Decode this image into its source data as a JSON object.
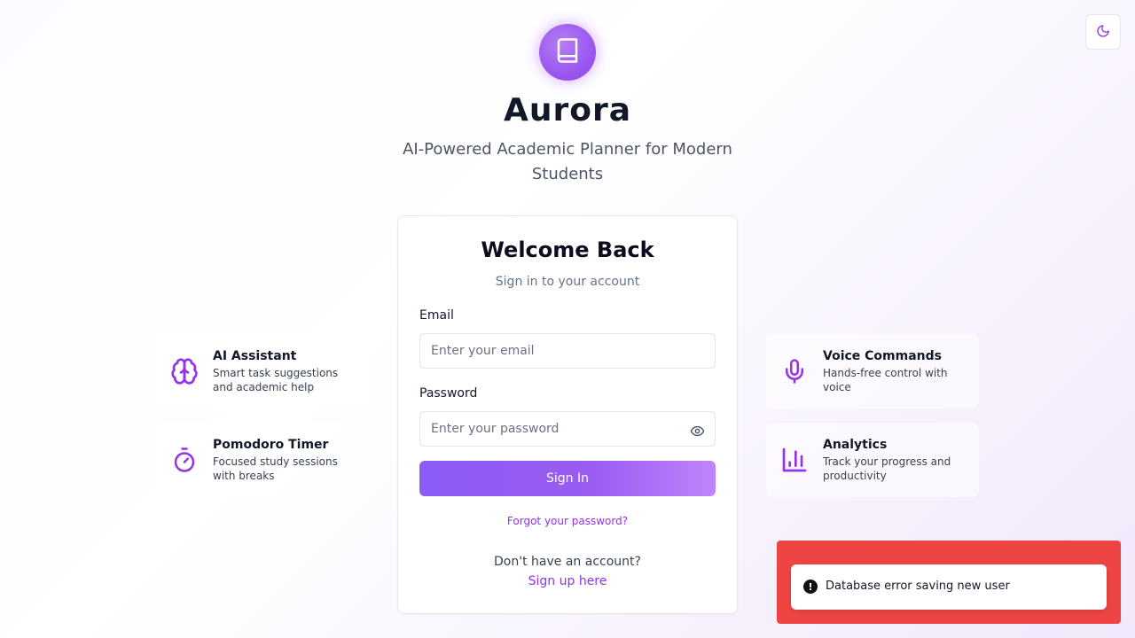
{
  "header": {
    "title": "Aurora",
    "subtitle": "AI-Powered Academic Planner for Modern Students",
    "logo_icon": "book-icon"
  },
  "theme_toggle": {
    "icon": "moon-icon"
  },
  "login": {
    "title": "Welcome Back",
    "subtitle": "Sign in to your account",
    "email_label": "Email",
    "email_placeholder": "Enter your email",
    "email_value": "",
    "password_label": "Password",
    "password_placeholder": "Enter your password",
    "password_value": "",
    "sign_in_label": "Sign In",
    "forgot_label": "Forgot your password?",
    "no_account_text": "Don't have an account?",
    "signup_label": "Sign up here"
  },
  "features": {
    "left": [
      {
        "title": "AI Assistant",
        "desc": "Smart task suggestions and academic help",
        "icon": "brain-icon"
      },
      {
        "title": "Pomodoro Timer",
        "desc": "Focused study sessions with breaks",
        "icon": "timer-icon"
      }
    ],
    "right": [
      {
        "title": "Voice Commands",
        "desc": "Hands-free control with voice",
        "icon": "microphone-icon"
      },
      {
        "title": "Analytics",
        "desc": "Track your progress and productivity",
        "icon": "bar-chart-icon"
      }
    ]
  },
  "toast": {
    "message": "Database error saving new user",
    "icon": "alert-icon"
  },
  "colors": {
    "accent": "#9333ea",
    "error": "#ef4444"
  }
}
